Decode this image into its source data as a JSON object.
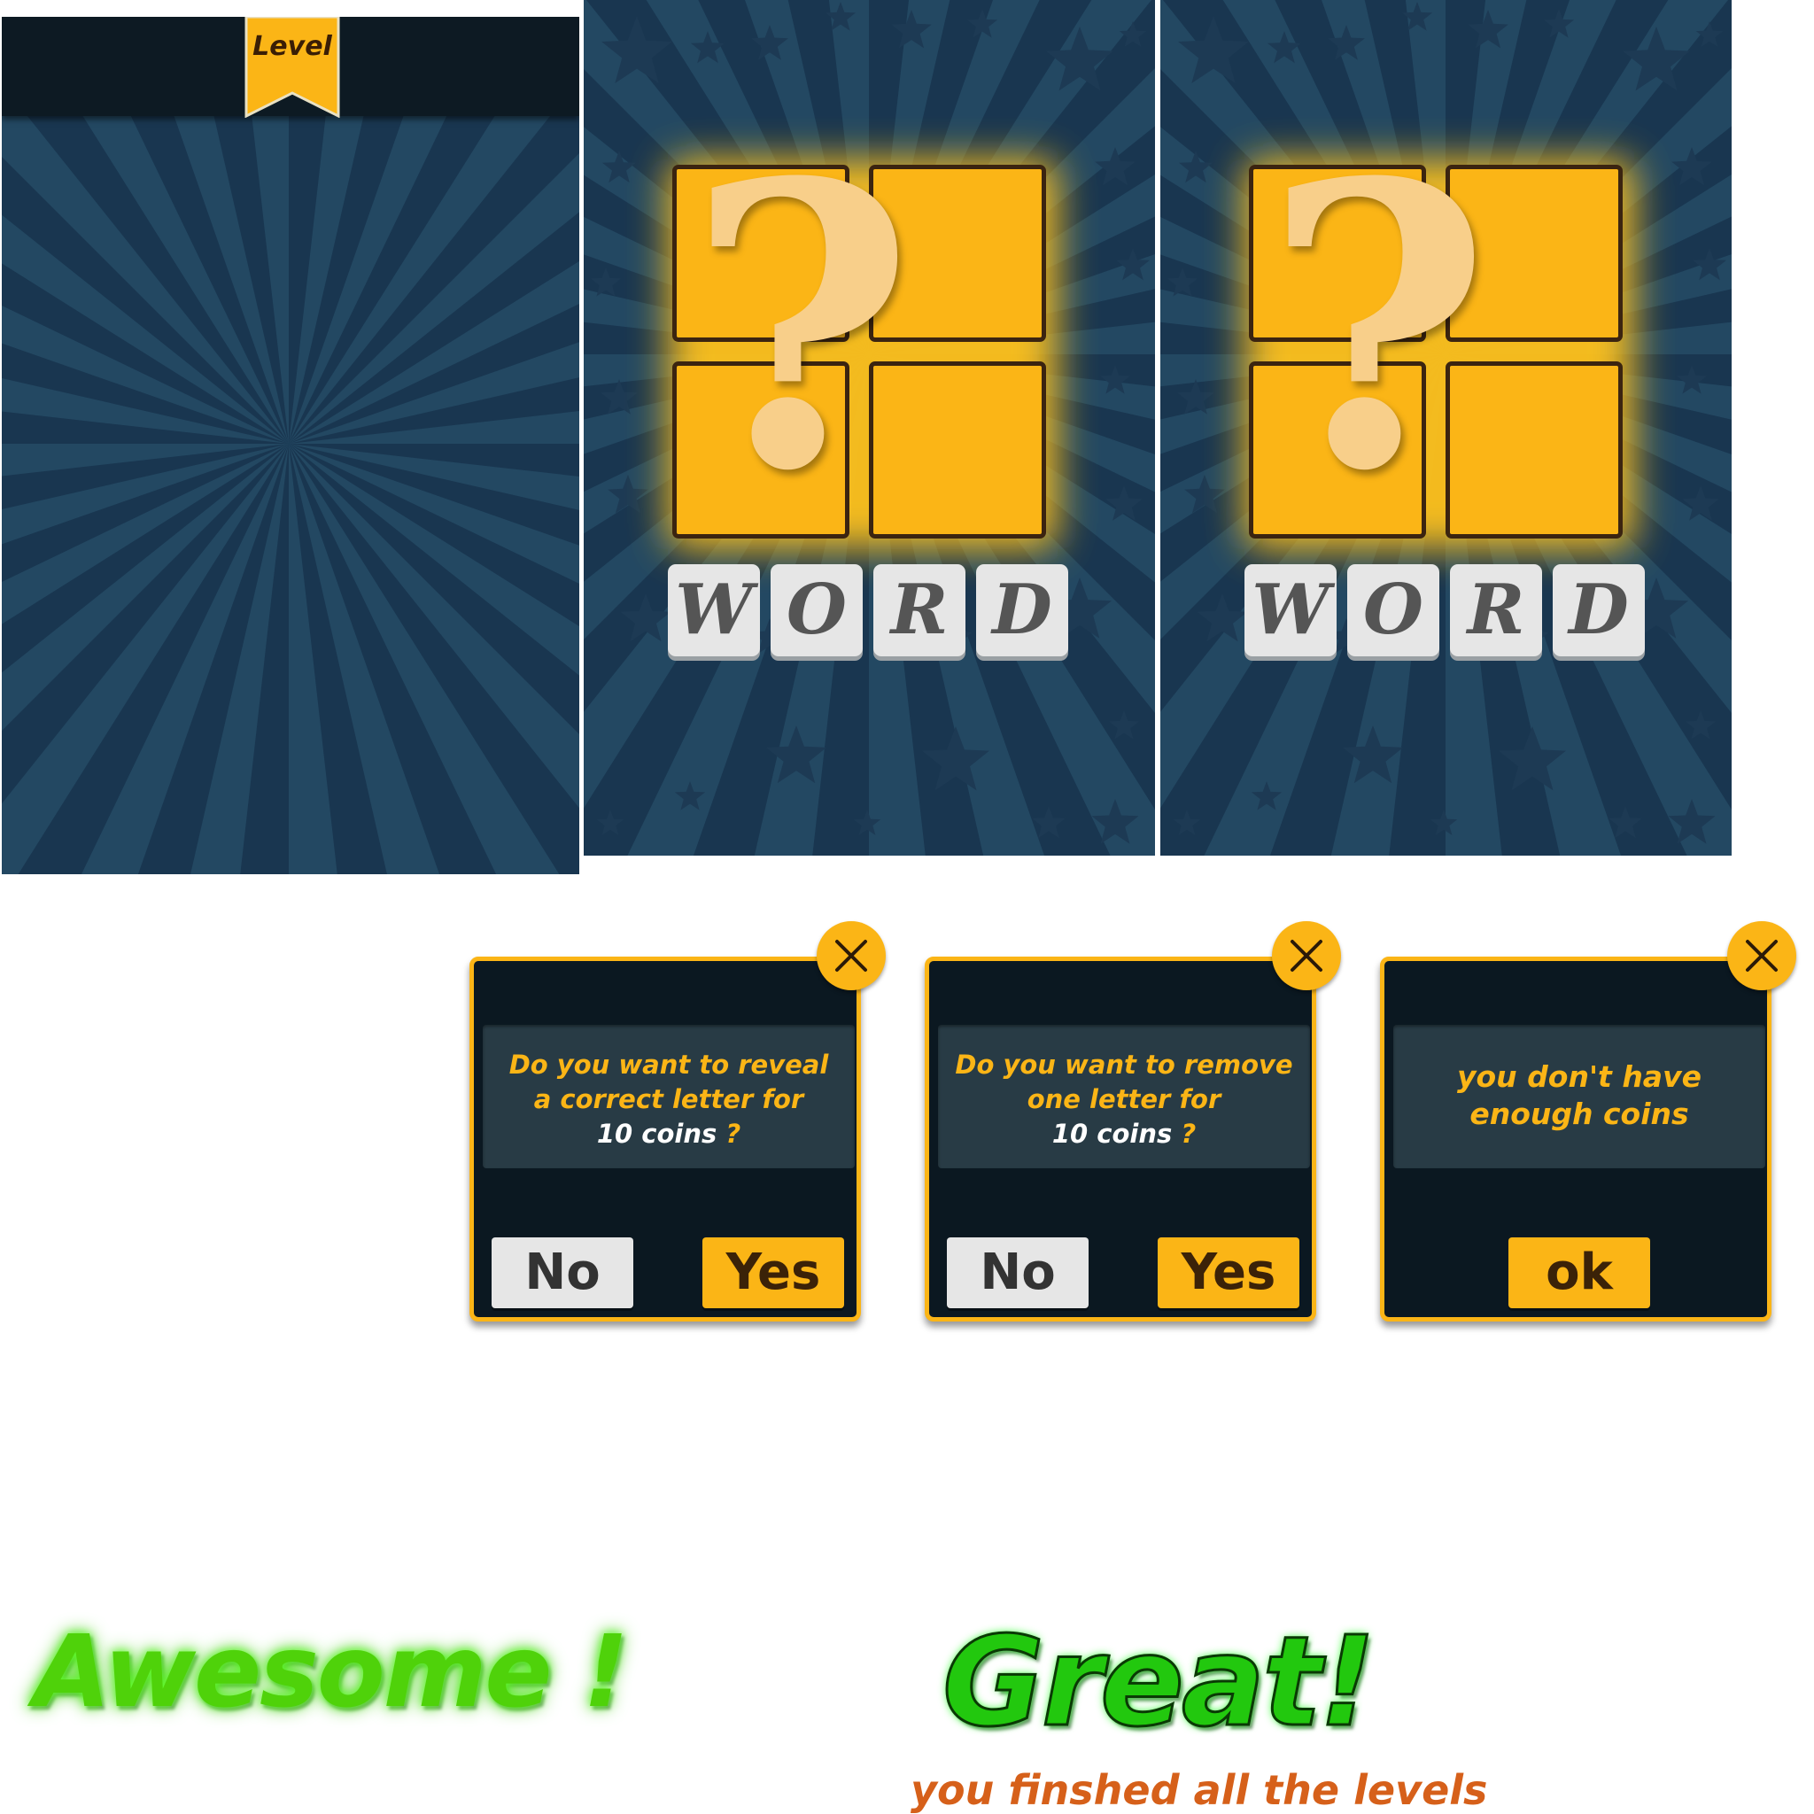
{
  "level_screen": {
    "ribbon_label": "Level"
  },
  "splash_screens": [
    {
      "tile_glyph": "?",
      "letters": [
        "W",
        "O",
        "R",
        "D"
      ]
    },
    {
      "tile_glyph": "?",
      "letters": [
        "W",
        "O",
        "R",
        "D"
      ]
    }
  ],
  "dialogs": [
    {
      "message_lines": [
        "Do you want to reveal",
        "a correct letter for"
      ],
      "cost_number": "10 coins",
      "cost_suffix": " ?",
      "buttons": {
        "no": "No",
        "yes": "Yes"
      }
    },
    {
      "message_lines": [
        "Do you want to remove",
        "one letter for"
      ],
      "cost_number": "10 coins",
      "cost_suffix": " ?",
      "buttons": {
        "no": "No",
        "yes": "Yes"
      }
    },
    {
      "message_lines": [
        "you don't have",
        "enough coins"
      ],
      "buttons": {
        "ok": "ok"
      }
    }
  ],
  "messages": {
    "awesome": "Awesome !",
    "great": "Great!",
    "finished": "you finshed all the levels"
  },
  "colors": {
    "background_light": "#234862",
    "background_dark": "#193650",
    "accent_yellow": "#fbb516",
    "dialog_dark": "#0b1821",
    "message_box": "#283b45",
    "tile_letter_bg": "#e6e6e6",
    "great_green": "#22c80e",
    "awesome_green": "#4fd20a",
    "finished_orange": "#d6601a"
  },
  "icons": {
    "close": "close-x-icon",
    "ribbon": "bookmark-ribbon-icon",
    "background_star": "star-icon"
  }
}
